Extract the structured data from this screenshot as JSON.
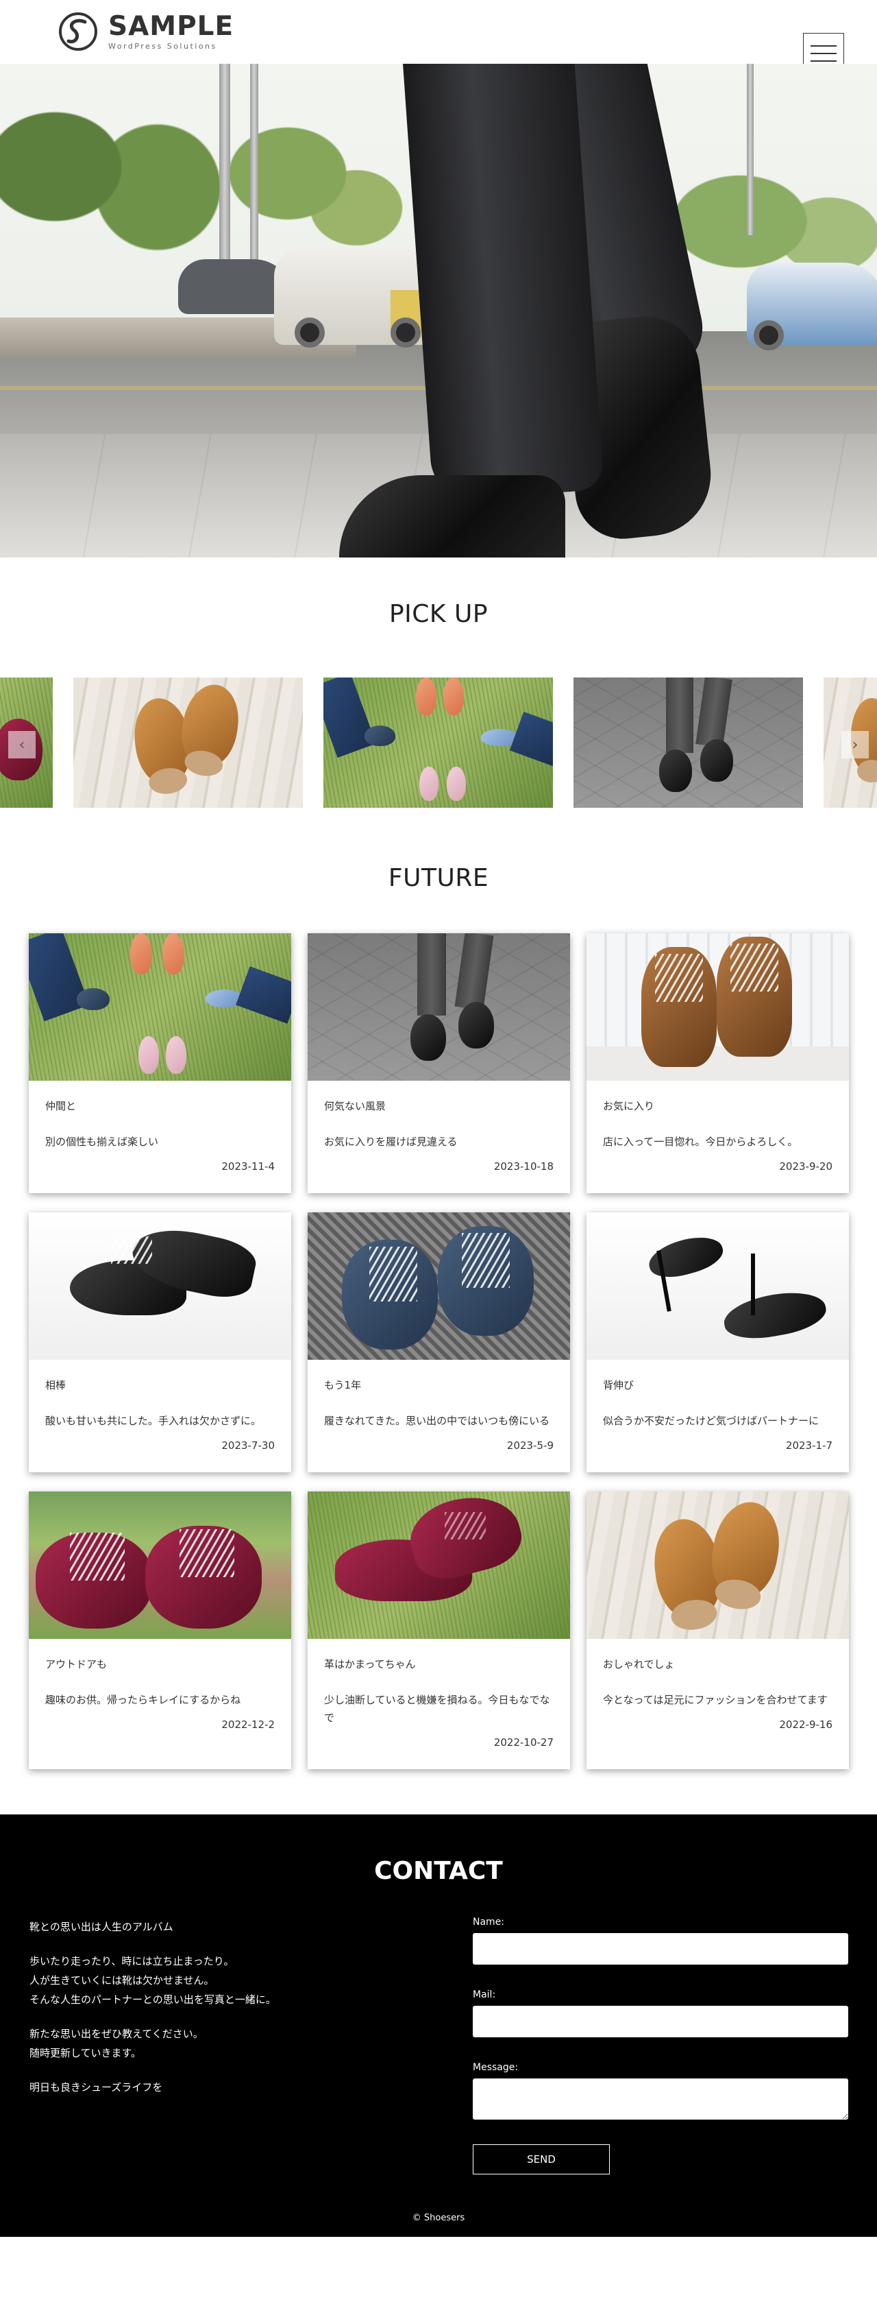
{
  "header": {
    "logo_title": "SAMPLE",
    "logo_sub": "WordPress Solutions",
    "menu_icon": "hamburger-icon"
  },
  "sections": {
    "pickup_title": "PICK UP",
    "future_title": "FUTURE",
    "contact_title": "CONTACT"
  },
  "slider": {
    "prev_icon": "chevron-left-icon",
    "next_icon": "chevron-right-icon",
    "prev_glyph": "‹",
    "next_glyph": "›"
  },
  "cards": [
    {
      "title": "仲間と",
      "text": "別の個性も揃えば楽しい",
      "date": "2023-11-4"
    },
    {
      "title": "何気ない風景",
      "text": "お気に入りを履けば見違える",
      "date": "2023-10-18"
    },
    {
      "title": "お気に入り",
      "text": "店に入って一目惚れ。今日からよろしく。",
      "date": "2023-9-20"
    },
    {
      "title": "相棒",
      "text": "酸いも甘いも共にした。手入れは欠かさずに。",
      "date": "2023-7-30"
    },
    {
      "title": "もう1年",
      "text": "履きなれてきた。思い出の中ではいつも傍にいる",
      "date": "2023-5-9"
    },
    {
      "title": "背伸び",
      "text": "似合うか不安だったけど気づけばパートナーに",
      "date": "2023-1-7"
    },
    {
      "title": "アウトドアも",
      "text": "趣味のお供。帰ったらキレイにするからね",
      "date": "2022-12-2"
    },
    {
      "title": "革はかまってちゃん",
      "text": "少し油断していると機嫌を損ねる。今日もなでなで",
      "date": "2022-10-27"
    },
    {
      "title": "おしゃれでしょ",
      "text": "今となっては足元にファッションを合わせてます",
      "date": "2022-9-16"
    }
  ],
  "contact": {
    "intro": "靴との思い出は人生のアルバム",
    "para1_line1": "歩いたり走ったり、時には立ち止まったり。",
    "para1_line2": "人が生きていくには靴は欠かせません。",
    "para1_line3": "そんな人生のパートナーとの思い出を写真と一緒に。",
    "para2_line1": "新たな思い出をぜひ教えてください。",
    "para2_line2": "随時更新していきます。",
    "closing": "明日も良きシューズライフを",
    "name_label": "Name:",
    "mail_label": "Mail:",
    "message_label": "Message:",
    "send_label": "SEND"
  },
  "footer": {
    "copyright": "© Shoesers"
  }
}
